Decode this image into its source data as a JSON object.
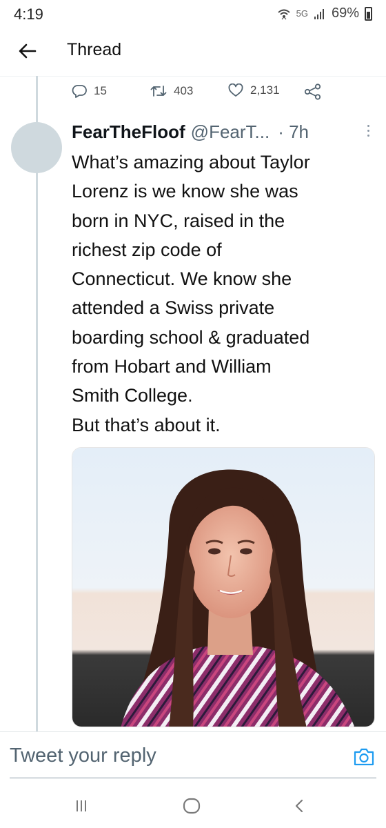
{
  "status_bar": {
    "time": "4:19",
    "network": "5G",
    "battery": "69%"
  },
  "header": {
    "title": "Thread",
    "back_icon": "arrow-left-icon"
  },
  "parent_actions": {
    "reply_count": "15",
    "retweet_count": "403",
    "like_count": "2,131",
    "icons": [
      "reply-icon",
      "retweet-icon",
      "like-icon",
      "share-icon"
    ]
  },
  "tweet": {
    "display_name": "FearTheFloof",
    "handle": "@FearT...",
    "time": "· 7h",
    "text_lines": [
      "What’s amazing about Taylor",
      "Lorenz is we know she was",
      "born in NYC, raised in the",
      "richest zip code of",
      "Connecticut. We know she",
      "attended a Swiss private",
      "boarding school & graduated",
      "from Hobart and William",
      "Smith College.",
      "But that’s about it."
    ]
  },
  "reply_bar": {
    "placeholder": "Tweet your reply",
    "camera_icon": "camera-icon"
  },
  "colors": {
    "accent": "#1d9bf0",
    "thread_line": "#cfd9de",
    "secondary_text": "#536471"
  }
}
